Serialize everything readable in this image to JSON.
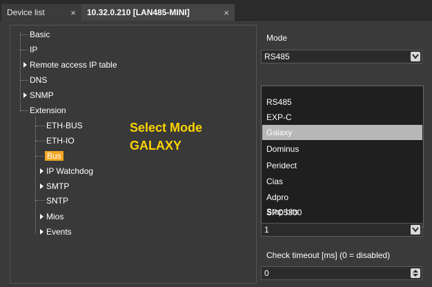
{
  "tabs": [
    {
      "label": "Device list",
      "close": "×"
    },
    {
      "label": "10.32.0.210 [LAN485-MINI]",
      "close": "×"
    }
  ],
  "tree": {
    "items": [
      {
        "label": "Basic"
      },
      {
        "label": "IP"
      },
      {
        "label": "Remote access IP table"
      },
      {
        "label": "DNS"
      },
      {
        "label": "SNMP"
      },
      {
        "label": "Extension"
      },
      {
        "label": "ETH-BUS"
      },
      {
        "label": "ETH-IO"
      },
      {
        "label": "Bus",
        "selected": true
      },
      {
        "label": "IP Watchdog"
      },
      {
        "label": "SMTP"
      },
      {
        "label": "SNTP"
      },
      {
        "label": "Mios"
      },
      {
        "label": "Events"
      }
    ]
  },
  "annotation": {
    "line1": "Select Mode",
    "line2": "GALAXY"
  },
  "settings": {
    "mode_label": "Mode",
    "mode_value": "RS485",
    "mode_options": [
      "RS485",
      "EXP-C",
      "Galaxy",
      "Dominus",
      "Peridect",
      "Cias",
      "Adpro",
      "SPC5300"
    ],
    "highlighted_option": "Galaxy",
    "stop_bits_label": "Stop bits",
    "stop_bits_value": "1",
    "check_timeout_label": "Check timeout [ms] (0 = disabled)",
    "check_timeout_value": "0"
  },
  "colors": {
    "accent": "#f5a623",
    "annotation": "#ffd400",
    "highlight": "#b7b7b7"
  }
}
